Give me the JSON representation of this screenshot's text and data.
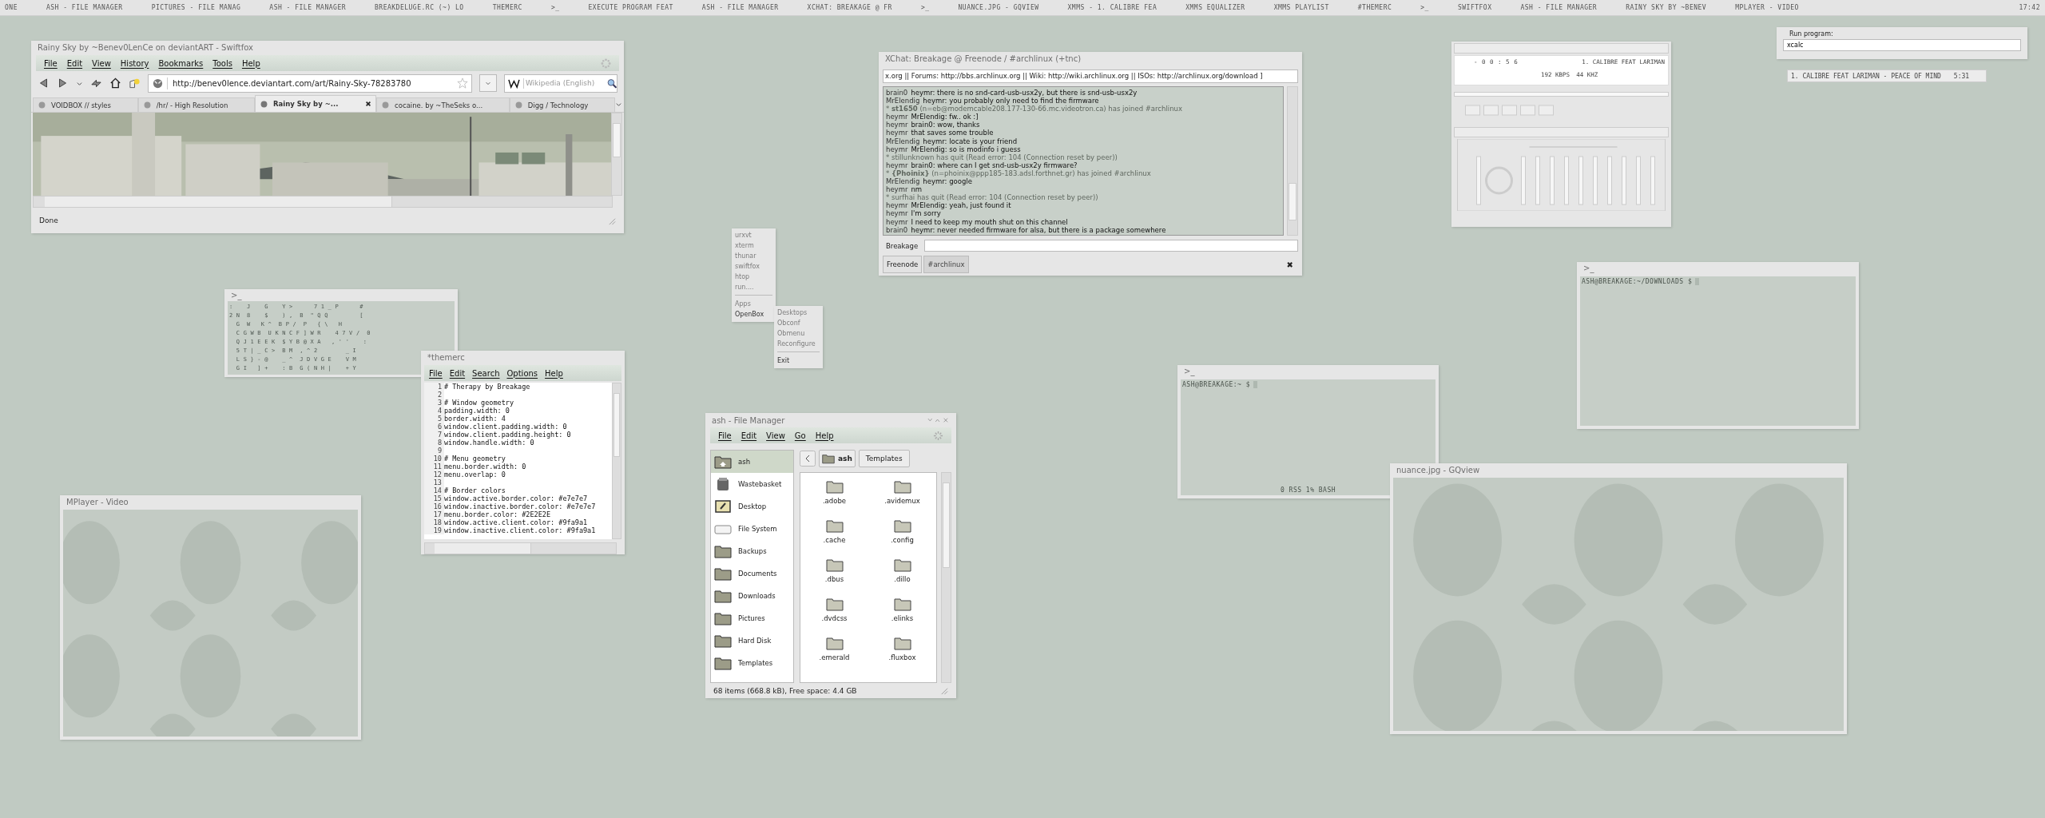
{
  "taskbar": [
    "ONE",
    "ASH - FILE MANAGER",
    "PICTURES - FILE MANAG",
    "ASH - FILE MANAGER",
    "BREAKDELUGE.RC (~) LO",
    "THEMERC",
    ">_",
    "EXECUTE PROGRAM FEAT",
    "ASH - FILE MANAGER",
    "XCHAT: BREAKAGE @ FR",
    ">_",
    "NUANCE.JPG - GQVIEW",
    "XMMS - 1. CALIBRE FEA",
    "XMMS EQUALIZER",
    "XMMS PLAYLIST",
    "#THEMERC",
    ">_",
    "SWIFTFOX",
    "ASH - FILE MANAGER",
    "RAINY SKY BY ~BENEV",
    "MPLAYER - VIDEO",
    "17:42"
  ],
  "browser": {
    "title": "Rainy Sky by ~Benev0LenCe on deviantART - Swiftfox",
    "menu": [
      "File",
      "Edit",
      "View",
      "History",
      "Bookmarks",
      "Tools",
      "Help"
    ],
    "url": "http://benev0lence.deviantart.com/art/Rainy-Sky-78283780",
    "search": {
      "placeholder": "Wikipedia (English)"
    },
    "tabs": [
      {
        "label": "VOIDBOX // styles",
        "selected": false
      },
      {
        "label": "/hr/ - High Resolution",
        "selected": false
      },
      {
        "label": "Rainy Sky by ~...",
        "selected": true
      },
      {
        "label": "cocaine. by ~TheSeks o...",
        "selected": false
      },
      {
        "label": "Digg / Technology",
        "selected": false
      }
    ],
    "status": "Done"
  },
  "matrix_terminal": {
    "title": ">_",
    "rows": [
      ":    J    G    Y >      7 1 _ P      #",
      "2 N  8    $    ) ,  B  \" Q Q         [",
      "  G  W   K ^  B P /  P   { \\   H",
      "  C G W B  U K N C F ] W R    4 7 V /  0",
      "  Q J 1 E E K  $ Y B @ X A   , ' '    :",
      "  5 T | _ C >  B M  , ^ 2        _ I",
      "  L S } - @    _ ^  J D V G E    V M",
      "  G I   ] +    : B  G ( N H |    + Y"
    ]
  },
  "editor": {
    "title": "*themerc",
    "menu": [
      "File",
      "Edit",
      "Search",
      "Options",
      "Help"
    ],
    "lines": [
      {
        "n": "1",
        "text": "# Therapy by Breakage"
      },
      {
        "n": "2"
      },
      {
        "n": "3",
        "text": "# Window geometry"
      },
      {
        "n": "4",
        "text": "padding.width: 0"
      },
      {
        "n": "5",
        "text": "border.width: 4"
      },
      {
        "n": "6",
        "text": "window.client.padding.width: 0"
      },
      {
        "n": "7",
        "text": "window.client.padding.height: 0"
      },
      {
        "n": "8",
        "text": "window.handle.width: 0"
      },
      {
        "n": "9"
      },
      {
        "n": "10",
        "text": "# Menu geometry"
      },
      {
        "n": "11",
        "text": "menu.border.width: 0"
      },
      {
        "n": "12",
        "text": "menu.overlap: 0"
      },
      {
        "n": "13"
      },
      {
        "n": "14",
        "text": "# Border colors"
      },
      {
        "n": "15",
        "text": "window.active.border.color: #e7e7e7"
      },
      {
        "n": "16",
        "text": "window.inactive.border.color: #e7e7e7"
      },
      {
        "n": "17",
        "text": "menu.border.color: #2E2E2E"
      },
      {
        "n": "18",
        "text": "window.active.client.color: #9fa9a1"
      },
      {
        "n": "19",
        "text": "window.inactive.client.color: #9fa9a1"
      }
    ]
  },
  "mplayer": {
    "title": "MPlayer - Video"
  },
  "root_menu": {
    "groups": [
      [
        {
          "label": "urxvt",
          "disabled": true
        },
        {
          "label": "xterm",
          "disabled": true
        },
        {
          "label": "thunar",
          "disabled": true
        },
        {
          "label": "swiftfox",
          "disabled": true
        },
        {
          "label": "htop",
          "disabled": true
        },
        {
          "label": "run....",
          "disabled": true
        }
      ],
      [
        {
          "label": "Apps",
          "disabled": true
        },
        {
          "label": "OpenBox",
          "disabled": false
        }
      ]
    ],
    "submenu": [
      [
        {
          "label": "Desktops",
          "disabled": true
        },
        {
          "label": "Obconf",
          "disabled": true
        },
        {
          "label": "Obmenu",
          "disabled": true
        },
        {
          "label": "Reconfigure",
          "disabled": true
        }
      ],
      [
        {
          "label": "Exit",
          "disabled": false
        }
      ]
    ]
  },
  "file_manager": {
    "title": "ash - File Manager",
    "menu": [
      "File",
      "Edit",
      "View",
      "Go",
      "Help"
    ],
    "places": [
      {
        "label": "ash",
        "kind": "home",
        "selected": true
      },
      {
        "label": "Wastebasket",
        "kind": "trash",
        "selected": false
      },
      {
        "label": "Desktop",
        "kind": "desktop",
        "selected": false
      },
      {
        "label": "File System",
        "kind": "drive",
        "selected": false
      },
      {
        "label": "Backups",
        "kind": "folder",
        "selected": false
      },
      {
        "label": "Documents",
        "kind": "folder",
        "selected": false
      },
      {
        "label": "Downloads",
        "kind": "folder",
        "selected": false
      },
      {
        "label": "Pictures",
        "kind": "folder",
        "selected": false
      },
      {
        "label": "Hard Disk",
        "kind": "folder",
        "selected": false
      },
      {
        "label": "Templates",
        "kind": "folder",
        "selected": false
      }
    ],
    "path": [
      {
        "label": "ash",
        "selected": true
      },
      {
        "label": "Templates",
        "selected": false
      }
    ],
    "files": [
      ".adobe",
      ".avidemux",
      ".cache",
      ".config",
      ".dbus",
      ".dillo",
      ".dvdcss",
      ".elinks",
      ".emerald",
      ".fluxbox"
    ],
    "status": "68 items (668.8 kB), Free space: 4.4 GB"
  },
  "xchat": {
    "title": "XChat: Breakage @ Freenode / #archlinux (+tnc)",
    "topic": "x.org || Forums: http://bbs.archlinux.org || Wiki: http://wiki.archlinux.org || ISOs: http://archlinux.org/download ]",
    "lines": [
      {
        "kind": "msg",
        "nick": "brain0",
        "text": "heymr: there is no snd-card-usb-usx2y, but there is snd-usb-usx2y"
      },
      {
        "kind": "msg",
        "nick": "MrElendig",
        "text": "heymr: you probably only need to find the firmware"
      },
      {
        "kind": "event",
        "text": "* **st1650** (n=eb@modemcable208.177-130-66.mc.videotron.ca) has joined #archlinux"
      },
      {
        "kind": "msg",
        "nick": "heymr",
        "text": "MrElendig: fw.. ok :]"
      },
      {
        "kind": "msg",
        "nick": "heymr",
        "text": "brain0: wow, thanks"
      },
      {
        "kind": "msg",
        "nick": "heymr",
        "text": "that saves some trouble"
      },
      {
        "kind": "msg",
        "nick": "MrElendig",
        "text": "heymr: locate is your friend"
      },
      {
        "kind": "msg",
        "nick": "heymr",
        "text": "MrElendig: so is modinfo i guess"
      },
      {
        "kind": "event",
        "text": "* stillunknown has quit (Read error: 104 (Connection reset by peer))"
      },
      {
        "kind": "msg",
        "nick": "heymr",
        "text": "brain0: where can I get snd-usb-usx2y firmware?"
      },
      {
        "kind": "event",
        "text": "* **{Phoinix}** (n=phoinix@ppp185-183.adsl.forthnet.gr) has joined #archlinux"
      },
      {
        "kind": "msg",
        "nick": "MrElendig",
        "text": "heymr: google"
      },
      {
        "kind": "msg",
        "nick": "heymr",
        "text": "nm"
      },
      {
        "kind": "event",
        "text": "* surfhai has quit (Read error: 104 (Connection reset by peer))"
      },
      {
        "kind": "msg",
        "nick": "heymr",
        "text": "MrElendig: yeah, just found it"
      },
      {
        "kind": "msg",
        "nick": "heymr",
        "text": "I'm sorry"
      },
      {
        "kind": "msg",
        "nick": "heymr",
        "text": "I need to keep my mouth shut on this channel"
      },
      {
        "kind": "msg",
        "nick": "brain0",
        "text": "heymr: never needed firmware for alsa, but there is a package somewhere"
      }
    ],
    "nick": "Breakage",
    "tabs": [
      {
        "label": "Freenode",
        "selected": false
      },
      {
        "label": "#archlinux",
        "selected": true
      }
    ],
    "close": "✖"
  },
  "xmms": {
    "time": "- 0 0 : 5 6",
    "track": "1. CALIBRE FEAT LARIMAN",
    "bitrate": "192 KBPS",
    "rate": "44 KHZ"
  },
  "run_dialog": {
    "label": "Run program:",
    "value": "xcalc"
  },
  "playlist": {
    "track": "1. CALIBRE FEAT LARIMAN - PEACE OF MIND",
    "length": "5:31"
  },
  "terminal_right": {
    "title": ">_",
    "prompt": "ASH@BREAKAGE:~/DOWNLOADS $"
  },
  "terminal_mid": {
    "title": ">_",
    "prompt": "ASH@BREAKAGE:~ $",
    "status": "0 RSS 1% BASH"
  },
  "gqview": {
    "title": "nuance.jpg - GQview"
  }
}
